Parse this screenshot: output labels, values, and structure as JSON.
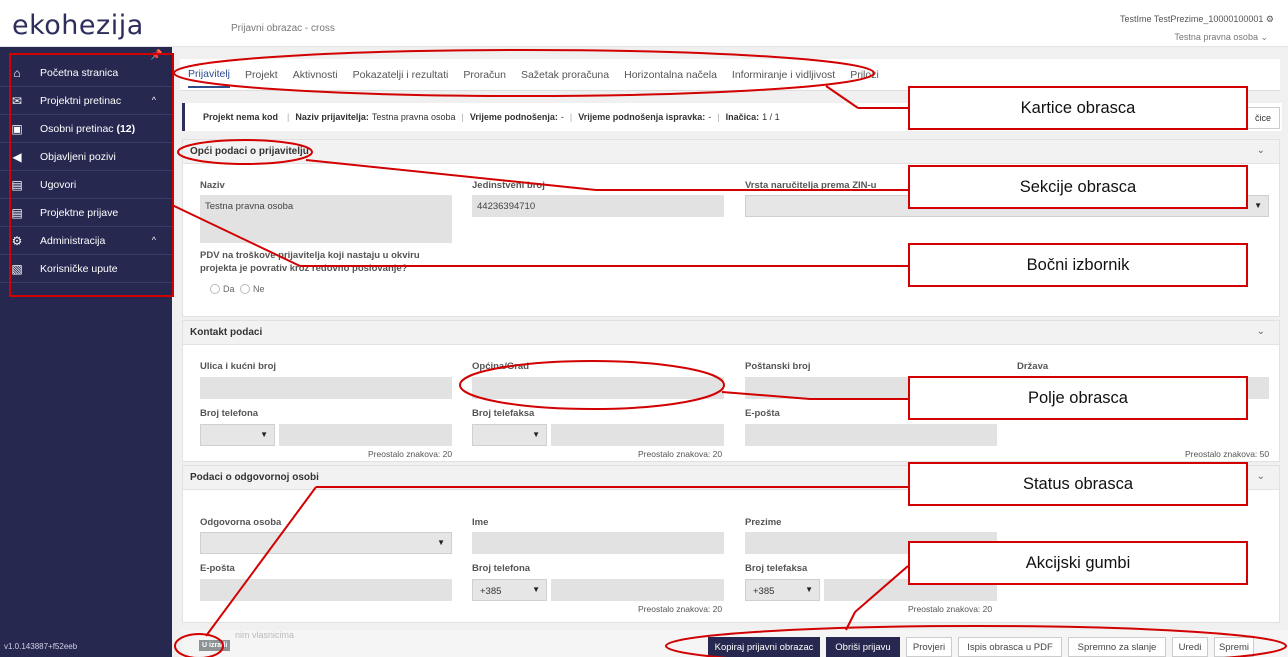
{
  "header": {
    "logo_text": "ekohezija",
    "doc_title": "Prijavni obrazac - cross",
    "user_name": "TestIme TestPrezime_10000100001",
    "user_org": "Testna pravna osoba"
  },
  "sidebar": {
    "items": [
      {
        "label": "Početna stranica",
        "icon": "home-icon"
      },
      {
        "label": "Projektni pretinac",
        "icon": "inbox-icon",
        "expandable": true
      },
      {
        "label": "Osobni pretinac",
        "badge": "(12)",
        "icon": "personal-inbox-icon"
      },
      {
        "label": "Objavljeni pozivi",
        "icon": "megaphone-icon"
      },
      {
        "label": "Ugovori",
        "icon": "contract-icon"
      },
      {
        "label": "Projektne prijave",
        "icon": "document-icon"
      },
      {
        "label": "Administracija",
        "icon": "cogs-icon",
        "expandable": true
      },
      {
        "label": "Korisničke upute",
        "icon": "manual-icon"
      }
    ],
    "version": "v1.0.143887+f52eeb"
  },
  "tabs": [
    "Prijavitelj",
    "Projekt",
    "Aktivnosti",
    "Pokazatelji i rezultati",
    "Proračun",
    "Sažetak proračuna",
    "Horizontalna načela",
    "Informiranje i vidljivost",
    "Prilozi"
  ],
  "infobar": {
    "project_code": "Projekt nema kod",
    "applicant_label": "Naziv prijavitelja:",
    "applicant_value": "Testna pravna osoba",
    "submitted_label": "Vrijeme podnošenja:",
    "submitted_value": "-",
    "corrected_label": "Vrijeme podnošenja ispravka:",
    "corrected_value": "-",
    "version_label": "Inačica:",
    "version_value": "1 / 1",
    "side_button": "čice"
  },
  "section_general": {
    "title": "Opći podaci o prijavitelju",
    "naziv_label": "Naziv",
    "naziv_value": "Testna pravna osoba",
    "jb_label": "Jedinstveni broj",
    "jb_value": "44236394710",
    "vrsta_label": "Vrsta naručitelja prema ZIN-u",
    "pdv_label_1": "PDV na troškove prijavitelja koji nastaju u okviru",
    "pdv_label_2": "projekta je povrativ kroz redovno poslovanje?",
    "radio_yes": "Da",
    "radio_no": "Ne"
  },
  "section_contact": {
    "title": "Kontakt podaci",
    "street_label": "Ulica i kućni broj",
    "city_label": "Općina/Grad",
    "postal_label": "Poštanski broj",
    "country_label": "Država",
    "phone_label": "Broj telefona",
    "fax_label": "Broj telefaksa",
    "email_label": "E-pošta",
    "remaining_20": "Preostalo znakova: 20",
    "remaining_50": "Preostalo znakova: 50"
  },
  "section_responsible": {
    "title": "Podaci o odgovornoj osobi",
    "person_label": "Odgovorna osoba",
    "first_name_label": "Ime",
    "last_name_label": "Prezime",
    "email_label": "E-pošta",
    "phone_label": "Broj telefona",
    "fax_label": "Broj telefaksa",
    "prefix": "+385",
    "remaining_20": "Preostalo znakova: 20"
  },
  "footer": {
    "faint_text": "nim vlasnicima",
    "status": "U izradi",
    "buttons": [
      "Kopiraj prijavni obrazac",
      "Obriši prijavu",
      "Provjeri",
      "Ispis obrasca u PDF",
      "Spremno za slanje",
      "Uredi",
      "Spremi"
    ]
  },
  "callouts": [
    "Kartice obrasca",
    "Sekcije obrasca",
    "Bočni izbornik",
    "Polje obrasca",
    "Status obrasca",
    "Akcijski gumbi"
  ],
  "colors": {
    "sidebar": "#26284f",
    "annotation": "#d20000",
    "primary_button": "#26284f"
  }
}
